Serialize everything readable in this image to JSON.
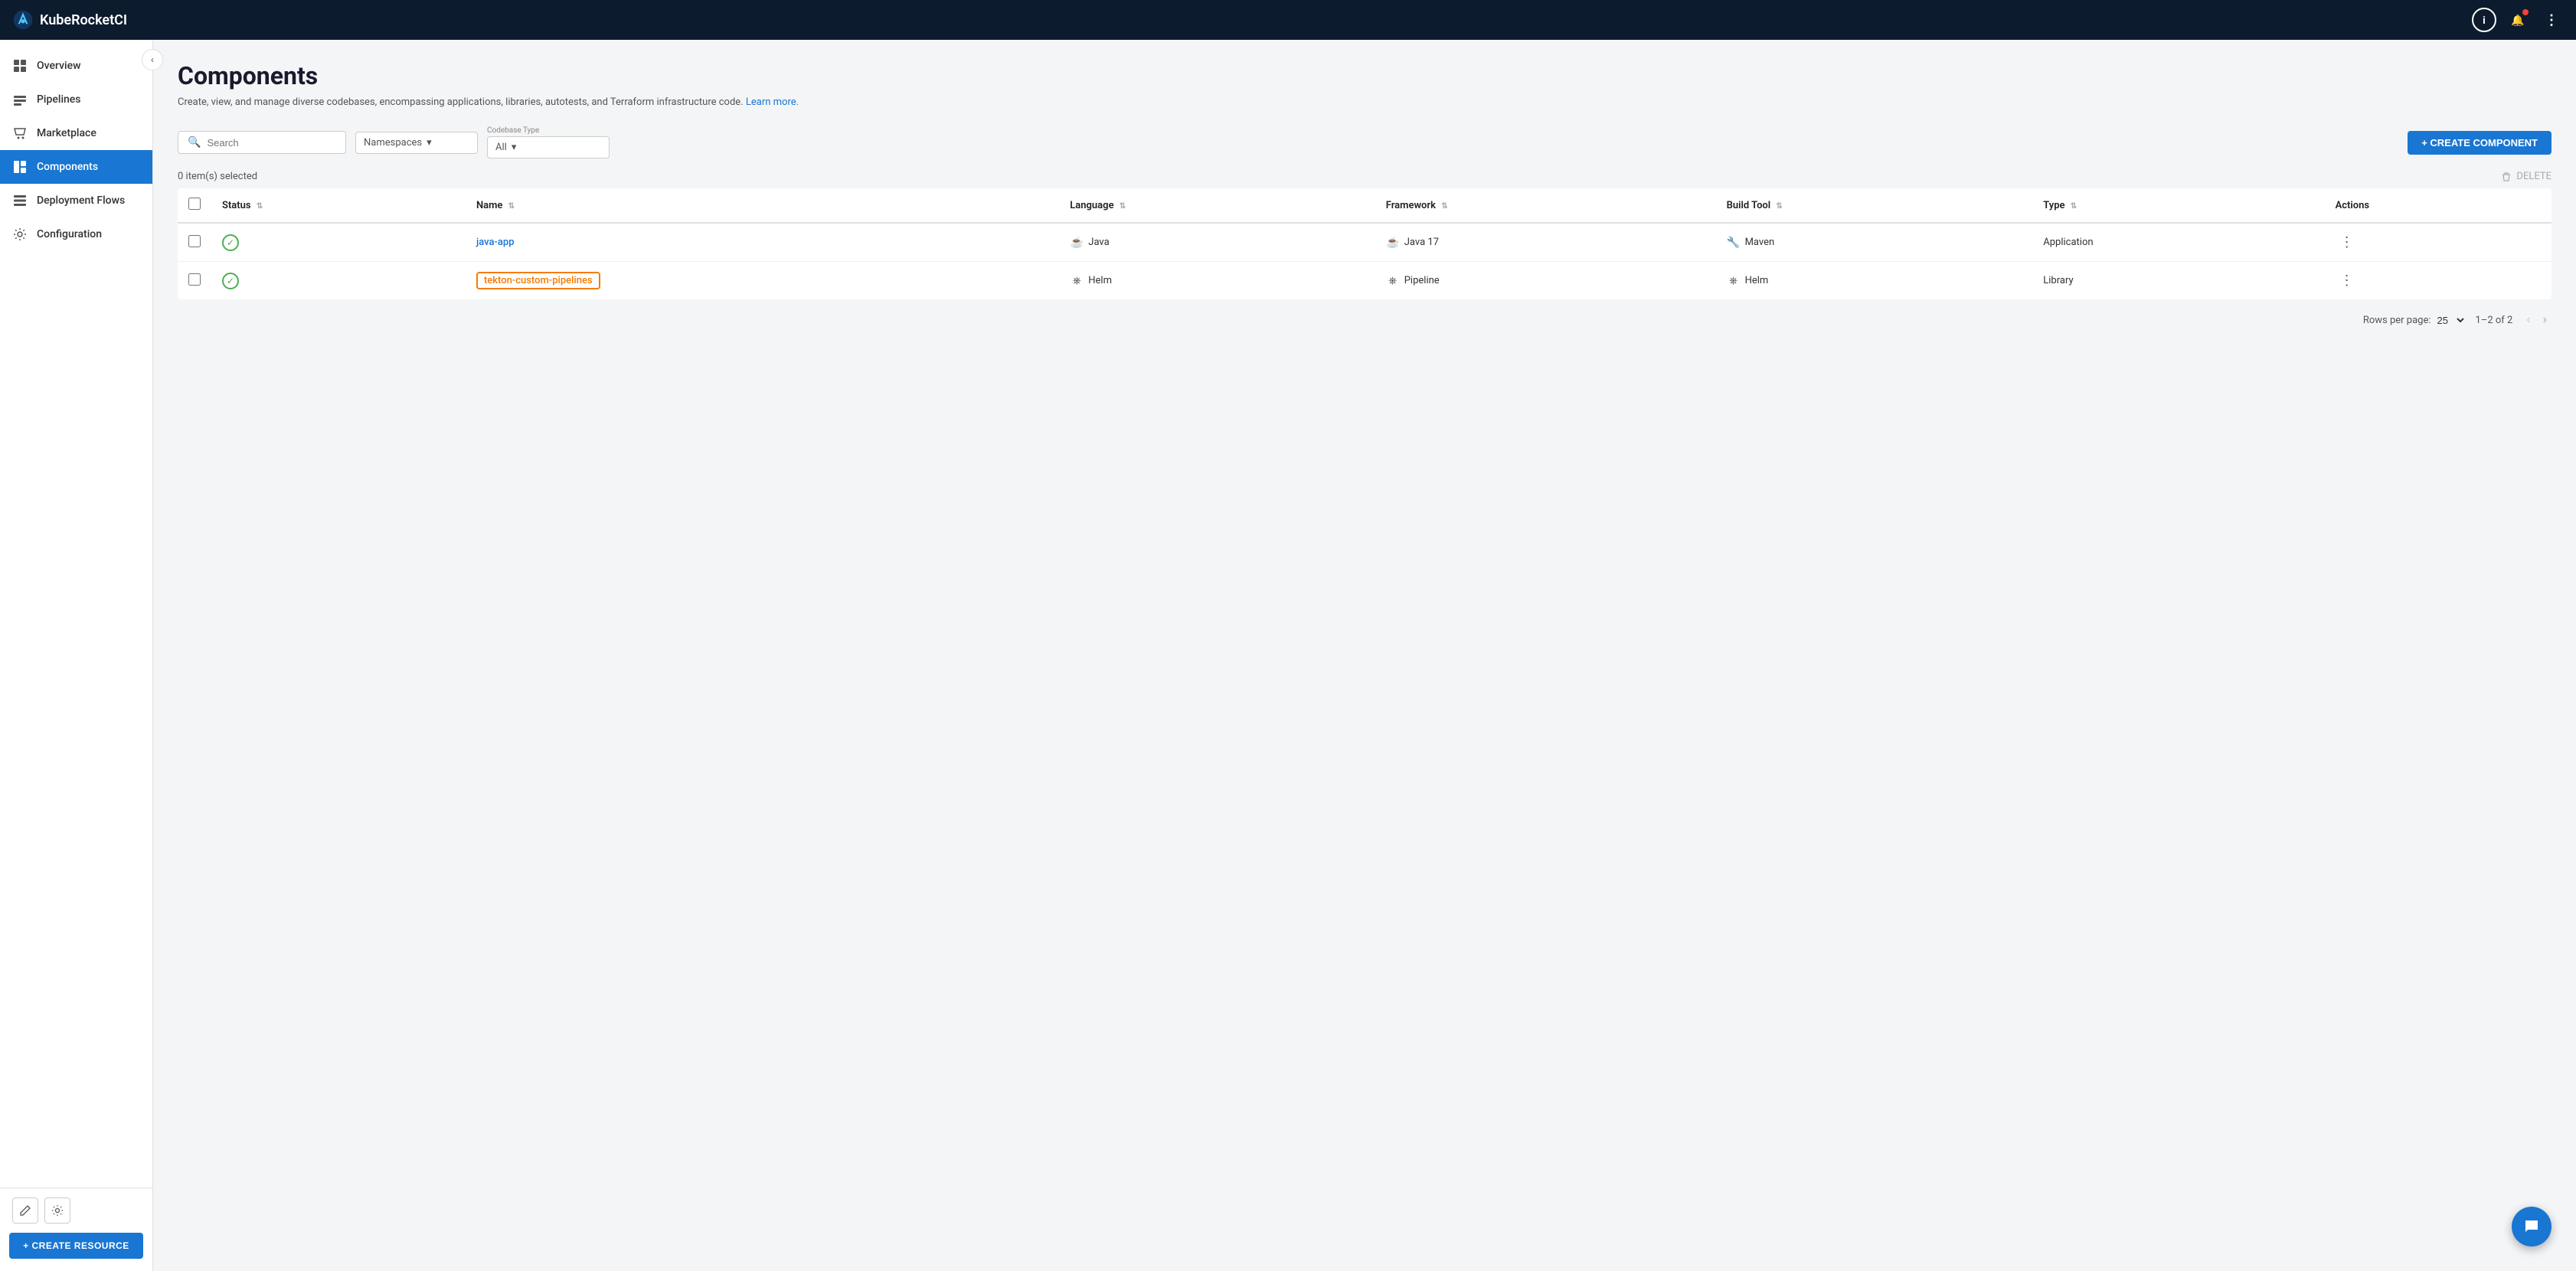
{
  "topnav": {
    "app_name": "KubeRocketCI",
    "info_label": "i",
    "notification_label": "🔔",
    "menu_label": "⋮"
  },
  "sidebar": {
    "collapse_icon": "‹",
    "items": [
      {
        "id": "overview",
        "label": "Overview",
        "icon": "grid"
      },
      {
        "id": "pipelines",
        "label": "Pipelines",
        "icon": "pipeline"
      },
      {
        "id": "marketplace",
        "label": "Marketplace",
        "icon": "cart"
      },
      {
        "id": "components",
        "label": "Components",
        "icon": "components",
        "active": true
      },
      {
        "id": "deployment-flows",
        "label": "Deployment Flows",
        "icon": "flows"
      },
      {
        "id": "configuration",
        "label": "Configuration",
        "icon": "gear"
      }
    ],
    "bottom": {
      "edit_icon": "✏",
      "settings_icon": "⚙"
    },
    "create_resource_label": "+ CREATE RESOURCE"
  },
  "main": {
    "page_title": "Components",
    "page_desc": "Create, view, and manage diverse codebases, encompassing applications, libraries, autotests, and Terraform infrastructure code.",
    "learn_more_label": "Learn more.",
    "learn_more_url": "#",
    "toolbar": {
      "search_placeholder": "Search",
      "namespaces_label": "Namespaces",
      "codebase_type_label": "Codebase Type",
      "codebase_type_value": "All",
      "create_component_label": "+ CREATE COMPONENT"
    },
    "table": {
      "selected_count": "0 item(s) selected",
      "delete_label": "DELETE",
      "columns": [
        {
          "id": "checkbox",
          "label": ""
        },
        {
          "id": "status",
          "label": "Status"
        },
        {
          "id": "name",
          "label": "Name"
        },
        {
          "id": "language",
          "label": "Language"
        },
        {
          "id": "framework",
          "label": "Framework"
        },
        {
          "id": "build_tool",
          "label": "Build Tool"
        },
        {
          "id": "type",
          "label": "Type"
        },
        {
          "id": "actions",
          "label": "Actions"
        }
      ],
      "rows": [
        {
          "status": "ok",
          "name": "java-app",
          "name_outlined": false,
          "language": "Java",
          "language_icon": "☕",
          "framework": "Java 17",
          "framework_icon": "☕",
          "build_tool": "Maven",
          "build_tool_icon": "🔧",
          "type": "Application"
        },
        {
          "status": "ok",
          "name": "tekton-custom-pipelines",
          "name_outlined": true,
          "language": "Helm",
          "language_icon": "⎈",
          "framework": "Pipeline",
          "framework_icon": "⎈",
          "build_tool": "Helm",
          "build_tool_icon": "⎈",
          "type": "Library"
        }
      ],
      "pagination": {
        "rows_per_page_label": "Rows per page:",
        "rows_per_page_value": "25",
        "range_label": "1–2 of 2"
      }
    }
  },
  "fab": {
    "icon": "💬"
  }
}
